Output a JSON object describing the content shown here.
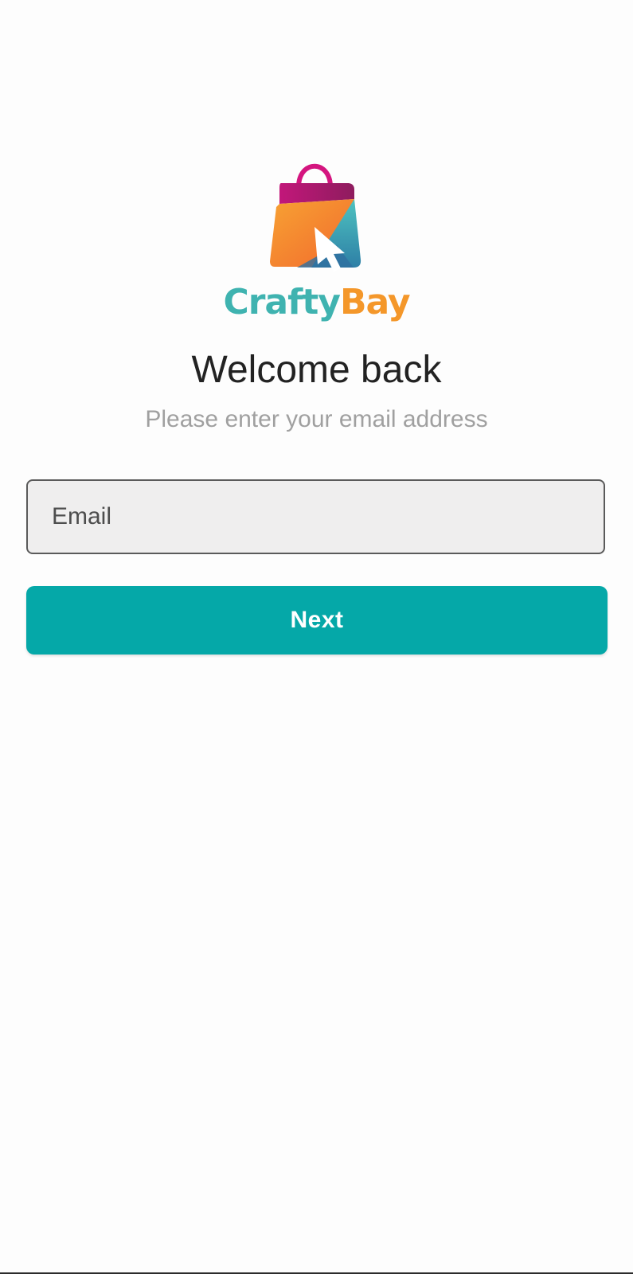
{
  "brand": {
    "name_part_1": "Crafty",
    "name_part_2": "Bay",
    "logo_icon": "shopping-bag-cursor-icon",
    "colors": {
      "teal": "#3fb3b0",
      "orange": "#f4972a",
      "magenta": "#c2177a"
    }
  },
  "header": {
    "title": "Welcome back",
    "subtitle": "Please enter your email address"
  },
  "form": {
    "email_placeholder": "Email",
    "email_value": ""
  },
  "actions": {
    "next_label": "Next",
    "accent": "#05a8a8"
  }
}
